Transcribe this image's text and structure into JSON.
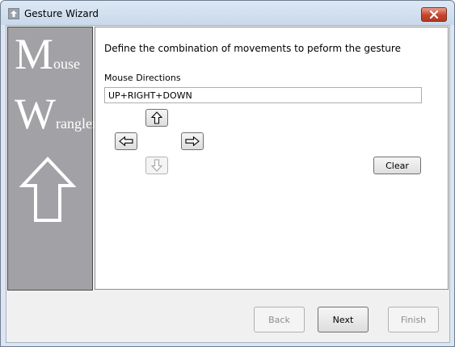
{
  "window": {
    "title": "Gesture Wizard",
    "icons": {
      "app": "up-arrow-icon",
      "close": "close-icon"
    }
  },
  "side_panel": {
    "logo": {
      "m_big": "M",
      "m_small": "ouse",
      "w_big": "W",
      "w_small": "rangler"
    },
    "art": "up-arrow-outline-icon",
    "background_color": "#a2a1a5"
  },
  "page": {
    "heading": "Define the combination of movements to peform the gesture",
    "directions_label": "Mouse Directions",
    "directions_value": "UP+RIGHT+DOWN",
    "arrow_buttons": {
      "up": "up-arrow-icon",
      "left": "left-arrow-icon",
      "right": "right-arrow-icon",
      "down": "down-arrow-icon"
    },
    "clear_label": "Clear"
  },
  "footer": {
    "back_label": "Back",
    "next_label": "Next",
    "finish_label": "Finish"
  }
}
